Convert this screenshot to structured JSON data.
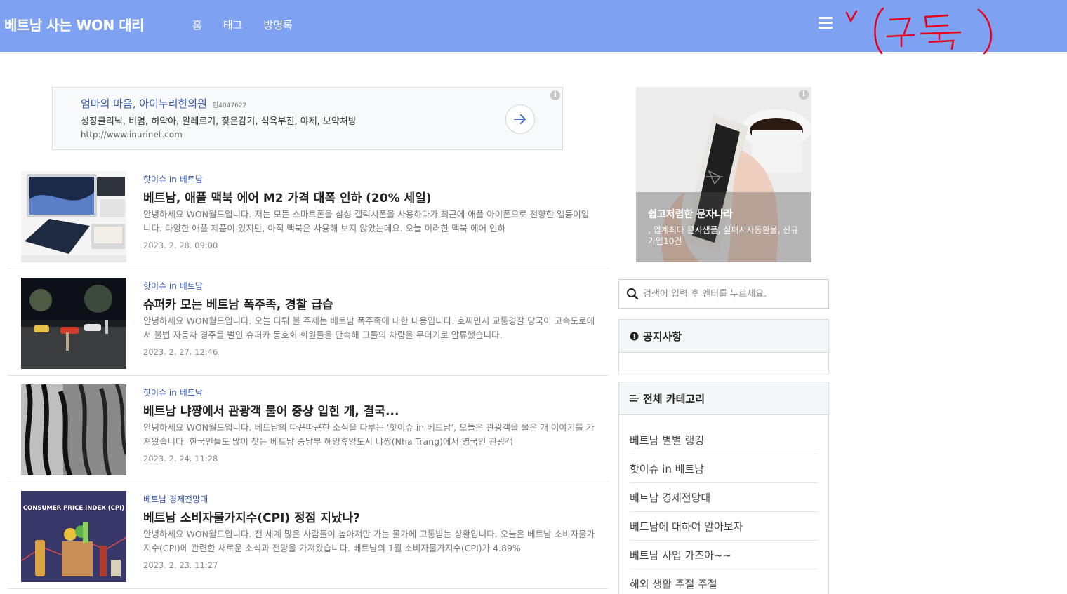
{
  "header": {
    "site_title": "베트남 사는 WON 대리",
    "nav": [
      "홈",
      "태그",
      "방명록"
    ],
    "annotation_text": "v (구독)"
  },
  "ad_top": {
    "title": "엄마의 마음, 아이누리한의원",
    "small": "한4047622",
    "desc": "성장클리닉, 비염, 허약아, 알레르기, 잦은감기, 식욕부진, 야제, 보약처방",
    "url": "http://www.inurinet.com"
  },
  "posts": [
    {
      "category": "핫이슈 in 베트남",
      "title": "베트남, 애플 맥북 에어 M2 가격 대폭 인하 (20% 세일)",
      "excerpt": "안녕하세요 WON월드입니다. 저는 모든 스마트폰을 삼성 갤럭시폰을 사용하다가 최근에 애플 아이폰으로 전향한 앱등이입니다. 다양한 애플 제품이 있지만, 아직 맥북은 사용해 보지 않았는데요. 오늘 이러한 맥북 에어 인하",
      "date": "2023. 2. 28. 09:00",
      "thumb_label": "MacBook Air"
    },
    {
      "category": "핫이슈 in 베트남",
      "title": "슈퍼카 모는 베트남 폭주족, 경찰 급습",
      "excerpt": "안녕하세요 WON월드입니다. 오늘 다뤄 볼 주제는 베트남 폭주족에 대한 내용입니다. 호찌민시 교통경찰 당국이 고속도로에서 불법 자동차 경주를 벌인 슈퍼카 동호회 회원들을 단속해 그들의 차량을 무더기로 압류했습니다.",
      "date": "2023. 2. 27. 12:46"
    },
    {
      "category": "핫이슈 in 베트남",
      "title": "베트남 냐짱에서 관광객 물어 중상 입힌 개, 결국...",
      "excerpt": "안녕하세요 WON월드입니다. 베트남의 따끈따끈한 소식을 다루는 '핫이슈 in 베트남', 오늘은 관광객을 물은 개 이야기를 가져왔습니다. 한국인들도 많이 찾는 베트남 중남부 해양휴양도시 냐짱(Nha Trang)에서 영국인 관광객",
      "date": "2023. 2. 24. 11:28"
    },
    {
      "category": "베트남 경제전망대",
      "title": "베트남 소비자물가지수(CPI) 정점 지났나?",
      "excerpt": "안녕하세요 WON월드입니다. 전 세계 많은 사람들이 높아져만 가는 물가에 고통받는 상황입니다. 오늘은 베트남 소비자물가지수(CPI)에 관련한 새로운 소식과 전망을 가져왔습니다. 베트남의 1월 소비자물가지수(CPI)가 4.89%",
      "date": "2023. 2. 23. 11:27",
      "thumb_label": "CONSUMER PRICE INDEX (CPI)"
    }
  ],
  "ad_side": {
    "title": "쉽고저렴한 문자나라",
    "desc": ", 업계최다 문자샘플, 실패시자동환불, 신규가입10건"
  },
  "search": {
    "placeholder": "검색어 입력 후 엔터를 누르세요."
  },
  "notice": {
    "title": "공지사항"
  },
  "categories": {
    "title": "전체 카테고리",
    "items": [
      "베트남 별별 랭킹",
      "핫이슈 in 베트남",
      "베트남 경제전망대",
      "베트남에 대하여 알아보자",
      "베트남 사업 가즈아~~",
      "해외 생활 주절 주절"
    ]
  },
  "colors": {
    "header_bg": "#7fa1f2",
    "link_blue": "#3557b7",
    "annotation_red": "#e8001c"
  }
}
